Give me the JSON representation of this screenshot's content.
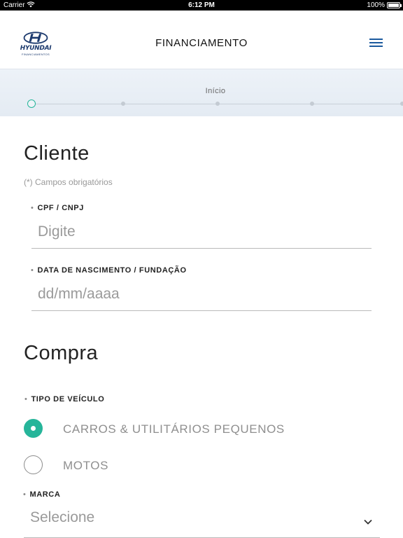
{
  "status_bar": {
    "carrier": "Carrier",
    "time": "6:12 PM",
    "battery": "100%",
    "battery_level": 1.0
  },
  "header": {
    "logo_brand": "HYUNDAI",
    "logo_sub": "FINANCIAMENTOS",
    "title": "FINANCIAMENTO"
  },
  "stepper": {
    "current_label": "Início",
    "current_step": 1,
    "visible_steps": 5
  },
  "cliente": {
    "title": "Cliente",
    "required_hint": "(*) Campos obrigatórios",
    "cpf": {
      "label": "CPF / CNPJ",
      "placeholder": "Digite",
      "value": ""
    },
    "birth": {
      "label": "DATA DE NASCIMENTO / FUNDAÇÃO",
      "placeholder": "dd/mm/aaaa",
      "value": ""
    }
  },
  "compra": {
    "title": "Compra",
    "vehicle_type": {
      "label": "TIPO DE VEÍCULO",
      "options": [
        {
          "label": "CARROS & UTILITÁRIOS PEQUENOS",
          "selected": true
        },
        {
          "label": "MOTOS",
          "selected": false
        }
      ]
    },
    "brand": {
      "label": "MARCA",
      "placeholder": "Selecione"
    }
  },
  "colors": {
    "accent": "#26b59a",
    "brand_blue": "#1c3a6e",
    "menu_blue": "#1c5a9e",
    "placeholder": "#9a9a9a"
  },
  "icons": {
    "menu": "hamburger-icon",
    "select_arrow": "chevron-down-icon",
    "wifi": "wifi-icon",
    "battery": "battery-icon"
  }
}
